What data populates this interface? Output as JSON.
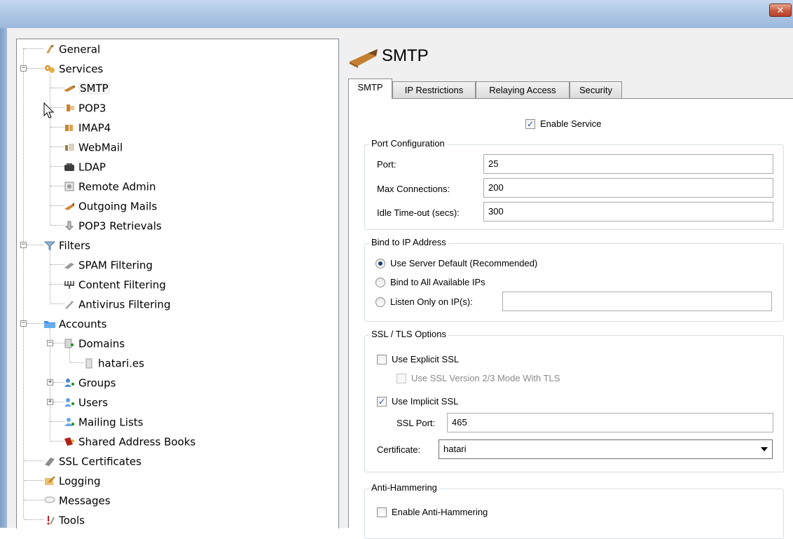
{
  "window": {
    "close_glyph": "✕"
  },
  "page": {
    "title": "SMTP",
    "icon": "smtp-arrow-icon"
  },
  "tree": {
    "general": "General",
    "services": "Services",
    "smtp": "SMTP",
    "pop3": "POP3",
    "imap4": "IMAP4",
    "webmail": "WebMail",
    "ldap": "LDAP",
    "remote_admin": "Remote Admin",
    "outgoing_mails": "Outgoing Mails",
    "pop3_retrievals": "POP3 Retrievals",
    "filters": "Filters",
    "spam_filtering": "SPAM Filtering",
    "content_filtering": "Content Filtering",
    "antivirus_filtering": "Antivirus Filtering",
    "accounts": "Accounts",
    "domains": "Domains",
    "hatari_es": "hatari.es",
    "groups": "Groups",
    "users": "Users",
    "mailing_lists": "Mailing Lists",
    "shared_address_books": "Shared Address Books",
    "ssl_certificates": "SSL Certificates",
    "logging": "Logging",
    "messages": "Messages",
    "tools": "Tools",
    "expand_minus": "−",
    "expand_plus": "+"
  },
  "tabs": {
    "smtp": "SMTP",
    "ip_restrictions": "IP Restrictions",
    "relaying_access": "Relaying Access",
    "security": "Security"
  },
  "enable_service": {
    "label": "Enable Service",
    "checked": true,
    "mark": "✓"
  },
  "port_config": {
    "title": "Port Configuration",
    "port_label": "Port:",
    "port_value": "25",
    "max_conn_label": "Max Connections:",
    "max_conn_value": "200",
    "idle_label": "Idle Time-out (secs):",
    "idle_value": "300"
  },
  "bind_ip": {
    "title": "Bind to IP Address",
    "opt_default": "Use Server Default (Recommended)",
    "opt_all": "Bind to All Available IPs",
    "opt_listen": "Listen Only on IP(s):",
    "selected": "opt_default",
    "listen_value": ""
  },
  "ssl": {
    "title": "SSL / TLS Options",
    "explicit_label": "Use Explicit SSL",
    "explicit_checked": false,
    "v23_label": "Use SSL Version 2/3 Mode With TLS",
    "v23_checked": false,
    "implicit_label": "Use Implicit SSL",
    "implicit_checked": true,
    "port_label": "SSL Port:",
    "port_value": "465",
    "cert_label": "Certificate:",
    "cert_value": "hatari"
  },
  "anti_hammer": {
    "title": "Anti-Hammering",
    "enable_label": "Enable Anti-Hammering",
    "enable_checked": false
  }
}
